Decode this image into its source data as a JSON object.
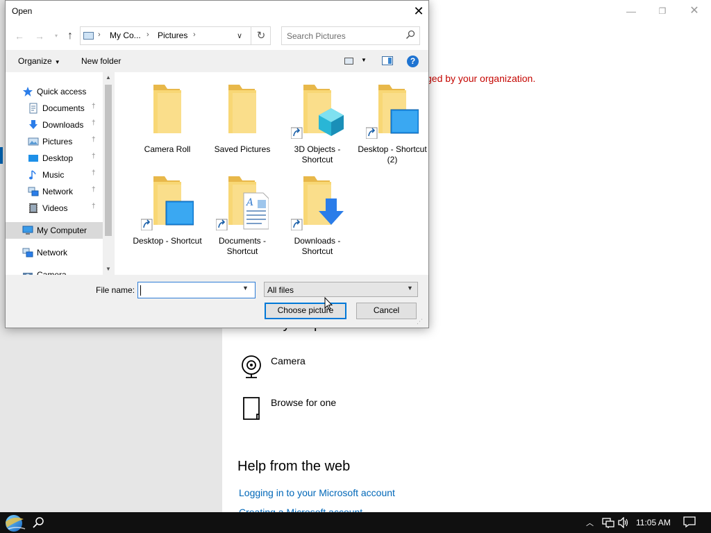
{
  "background": {
    "warning_text": "ged by your organization.",
    "create_heading": "Create your picture",
    "options": [
      {
        "label": "Camera",
        "icon": "webcam-icon"
      },
      {
        "label": "Browse for one",
        "icon": "file-icon"
      }
    ],
    "help_heading": "Help from the web",
    "links": [
      "Logging in to your Microsoft account",
      "Creating a Microsoft account"
    ],
    "window_controls": {
      "minimize": "—",
      "maximize": "❐",
      "close": "✕"
    }
  },
  "dialog": {
    "title": "Open",
    "close_glyph": "✕",
    "nav": {
      "back": "←",
      "forward": "→",
      "recent": "▾",
      "up": "↑"
    },
    "address": {
      "crumbs": [
        "My Co...",
        "Pictures"
      ],
      "separator": "›",
      "dropdown": "∨",
      "refresh": "↻"
    },
    "search": {
      "placeholder": "Search Pictures",
      "icon": "search-icon"
    },
    "toolbar": {
      "organize": "Organize",
      "new_folder": "New folder",
      "help": "?"
    },
    "nav_pane": {
      "items": [
        {
          "label": "Quick access",
          "icon": "star-icon",
          "level": 0,
          "pinned": false
        },
        {
          "label": "Documents",
          "icon": "documents-icon",
          "level": 1,
          "pinned": true
        },
        {
          "label": "Downloads",
          "icon": "downloads-icon",
          "level": 1,
          "pinned": true
        },
        {
          "label": "Pictures",
          "icon": "pictures-icon",
          "level": 1,
          "pinned": true
        },
        {
          "label": "Desktop",
          "icon": "desktop-icon",
          "level": 1,
          "pinned": true
        },
        {
          "label": "Music",
          "icon": "music-icon",
          "level": 1,
          "pinned": true
        },
        {
          "label": "Network",
          "icon": "network-icon",
          "level": 1,
          "pinned": true
        },
        {
          "label": "Videos",
          "icon": "videos-icon",
          "level": 1,
          "pinned": true
        },
        {
          "label": "My Computer",
          "icon": "computer-icon",
          "level": 0,
          "pinned": false,
          "selected": true
        },
        {
          "label": "Network",
          "icon": "network-icon",
          "level": 0,
          "pinned": false
        },
        {
          "label": "Camera",
          "icon": "camera-icon",
          "level": 0,
          "pinned": false
        }
      ]
    },
    "files": [
      {
        "label": "Camera Roll",
        "overlay": "none",
        "shortcut": false
      },
      {
        "label": "Saved Pictures",
        "overlay": "none",
        "shortcut": false
      },
      {
        "label": "3D Objects - Shortcut",
        "overlay": "cube",
        "shortcut": true
      },
      {
        "label": "Desktop - Shortcut (2)",
        "overlay": "desktop",
        "shortcut": true
      },
      {
        "label": "Desktop - Shortcut",
        "overlay": "desktop",
        "shortcut": true
      },
      {
        "label": "Documents - Shortcut",
        "overlay": "document",
        "shortcut": true
      },
      {
        "label": "Downloads - Shortcut",
        "overlay": "download",
        "shortcut": true
      }
    ],
    "file_name": {
      "label": "File name:",
      "value": ""
    },
    "filter": {
      "value": "All files"
    },
    "buttons": {
      "choose": "Choose picture",
      "cancel": "Cancel"
    }
  },
  "taskbar": {
    "clock": "11:05 AM",
    "tray_icons": [
      "chevron-up-icon",
      "network-icon",
      "volume-icon",
      "notification-icon"
    ]
  },
  "colors": {
    "accent": "#0078d7",
    "warning": "#c50500",
    "link": "#0067b8",
    "folder": "#f8d775",
    "taskbar": "#101010"
  }
}
